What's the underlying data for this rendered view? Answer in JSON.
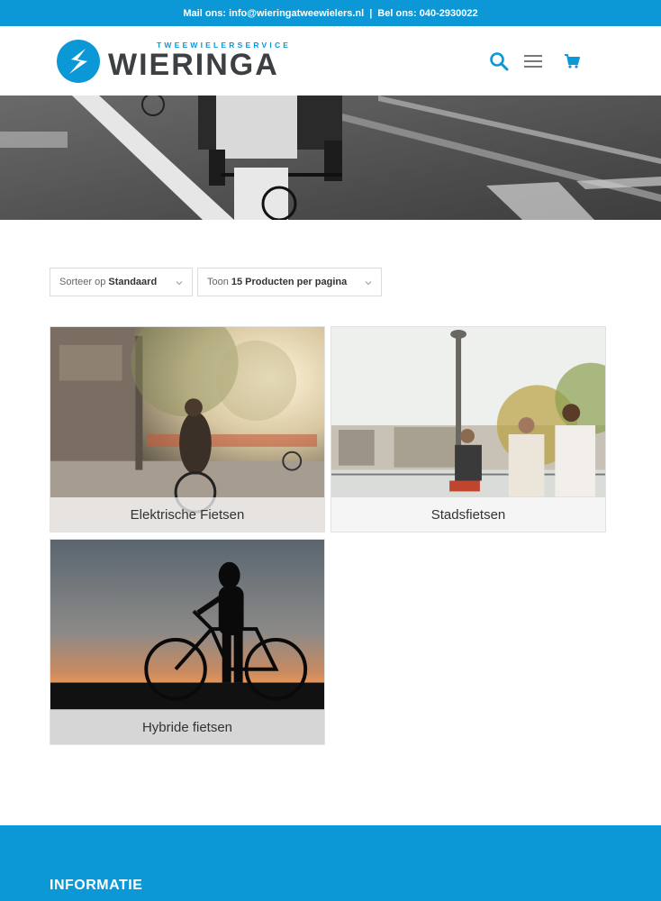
{
  "topbar": {
    "mail": "Mail ons: info@wieringatweewielers.nl",
    "separator": "|",
    "phone": "Bel ons: 040-2930022"
  },
  "header": {
    "logo_tagline": "TWEEWIELERSERVICE",
    "logo_brand": "WIERINGA",
    "icons": [
      "search-icon",
      "menu-icon",
      "cart-icon"
    ]
  },
  "sorting": {
    "order_prefix": "Sorteer op",
    "order_value": "Standaard",
    "count_prefix": "Toon",
    "count_value": "15 Producten per pagina"
  },
  "categories": [
    {
      "title": "Elektrische Fietsen"
    },
    {
      "title": "Stadsfietsen"
    },
    {
      "title": "Hybride fietsen"
    }
  ],
  "footer": {
    "heading": "INFORMATIE"
  },
  "colors": {
    "accent": "#0c98d7",
    "text": "#333333",
    "logo_gray": "#3c4043"
  }
}
